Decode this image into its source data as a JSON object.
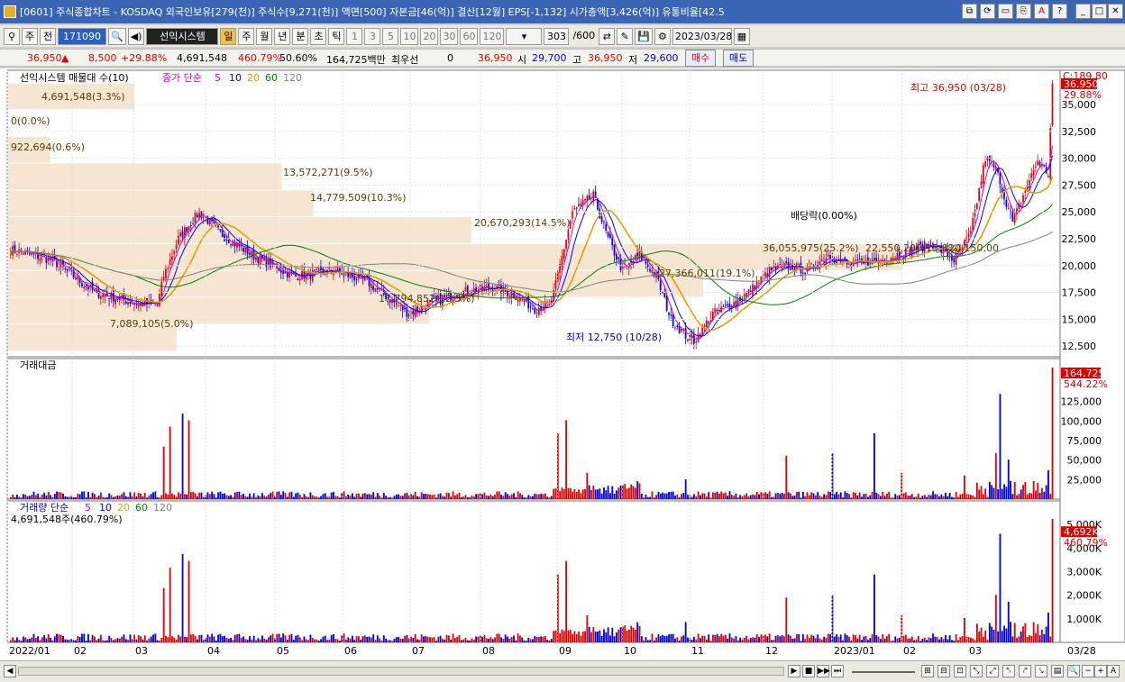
{
  "window": {
    "title": "[0601] 주식종합차트 - KOSDAQ 외국인보유[279(천)] 주식수[9,271(천)] 액면[500] 자본금[46(억)] 결산[12월] EPS[-1,132] 시가총액[3,426(억)] 유통비율[42.5"
  },
  "toolbar": {
    "period": "주",
    "prev": "전",
    "code": "171090",
    "system": "선익시스템",
    "intervals": [
      "일",
      "주",
      "월",
      "년",
      "분",
      "초",
      "틱"
    ],
    "minutes": [
      "1",
      "3",
      "5",
      "10",
      "20",
      "30",
      "60",
      "120"
    ],
    "count": "303",
    "count_total": "/600",
    "date": "2023/03/28"
  },
  "quote": {
    "price": "36,950",
    "change": "8,500",
    "pct": "+29.88%",
    "volume": "4,691,548",
    "vol_ratio": "460.79%",
    "rotation": "50.60%",
    "amount": "164,725백만",
    "preferred": "최우선",
    "pref_val": "0",
    "ask": "36,950",
    "open_label": "시",
    "open": "29,700",
    "high_label": "고",
    "high": "36,950",
    "low_label": "저",
    "low": "29,600",
    "buy": "매수",
    "sell": "매도"
  },
  "price_panel": {
    "title": "선익시스템 매물대 수(10)",
    "ma_label": "종가 단순",
    "ma": [
      "5",
      "10",
      "20",
      "60",
      "120"
    ],
    "ma_colors": [
      "#d000d0",
      "#0000ff",
      "#e0a000",
      "#008000",
      "#808080"
    ],
    "max_label": "최고 36,950 (03/28)",
    "min_label": "최저 12,750 (10/28)",
    "div_label": "배당락(0.00%)",
    "price_tag": "36,950",
    "pct_tag": "29.88%",
    "scale_top": "C:189.80",
    "scale": [
      "35,000",
      "32,500",
      "30,000",
      "27,500",
      "25,000",
      "22,500",
      "20,000",
      "17,500",
      "15,000",
      "12,500"
    ]
  },
  "volume_profile": [
    {
      "label": "4,691,548(3.3%)"
    },
    {
      "label": "0(0.0%)"
    },
    {
      "label": "922,694(0.6%)"
    },
    {
      "label": "13,572,271(9.5%)"
    },
    {
      "label": "14,779,509(10.3%)"
    },
    {
      "label": "20,670,293(14.5%)"
    },
    {
      "label": "36,055,975(25.2%)"
    },
    {
      "label": "22,550,200(15.8%)"
    },
    {
      "label": "20,150,00"
    },
    {
      "label": "27,366,011(19.1%)"
    },
    {
      "label": "17,794,852(12.5%)"
    },
    {
      "label": "7,089,105(5.0%)"
    }
  ],
  "amount_panel": {
    "title": "거래대금",
    "tag": "164,725",
    "tag_pct": "544.22%",
    "scale": [
      "125,000",
      "100,000",
      "75,000",
      "50,000",
      "25,000"
    ]
  },
  "volume_panel": {
    "title": "거래량 단순",
    "ma": [
      "5",
      "10",
      "20",
      "60",
      "120"
    ],
    "value_label": "4,691,548주(460.79%)",
    "tag": "4,692K",
    "tag_pct": "460.79%",
    "scale": [
      "5,000K",
      "4,000K",
      "3,000K",
      "2,000K",
      "1,000K"
    ]
  },
  "x_axis": {
    "labels": [
      "2022/01",
      "02",
      "03",
      "04",
      "05",
      "06",
      "07",
      "08",
      "09",
      "10",
      "11",
      "12",
      "2023/01",
      "02",
      "03"
    ],
    "current": "03/28"
  }
}
